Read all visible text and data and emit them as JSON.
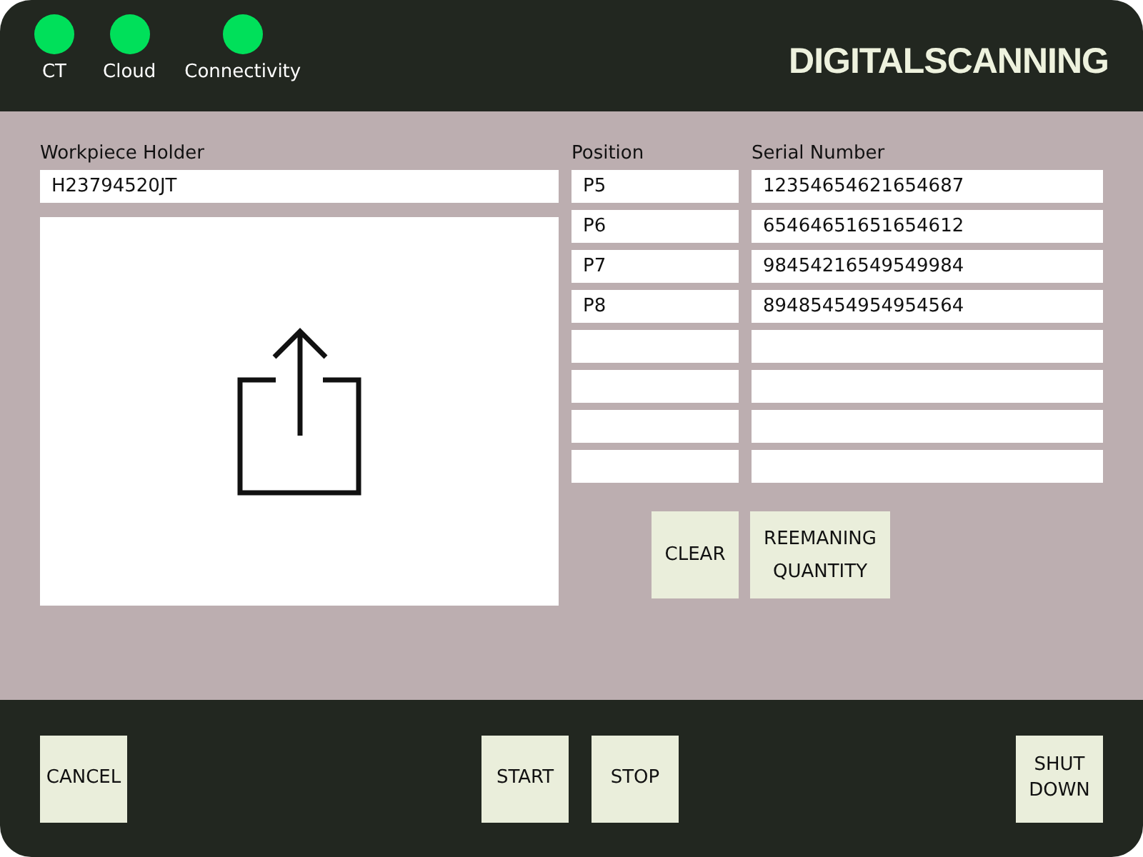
{
  "header": {
    "indicators": [
      {
        "label": "CT",
        "color": "#00e05a"
      },
      {
        "label": "Cloud",
        "color": "#00e05a"
      },
      {
        "label": "Connectivity",
        "color": "#00e05a"
      }
    ],
    "title": "DIGITALSCANNING"
  },
  "workpiece": {
    "label": "Workpiece Holder",
    "value": "H23794520JT",
    "upload": {
      "kind": "picture-upload"
    }
  },
  "table": {
    "columns": [
      "Position",
      "Serial Number"
    ],
    "rows": [
      {
        "kind": "filled",
        "position": "P5",
        "serial": "12354654621654687"
      },
      {
        "kind": "filled",
        "position": "P6",
        "serial": "65464651651654612"
      },
      {
        "kind": "filled",
        "position": "P7",
        "serial": "98454216549549984"
      },
      {
        "kind": "filled",
        "position": "P8",
        "serial": "89485454954954564"
      },
      {
        "kind": "blank"
      },
      {
        "kind": "blank"
      },
      {
        "kind": "blank"
      },
      {
        "kind": "blank"
      }
    ]
  },
  "actions": [
    "CLEAR",
    "REEMANING QUANTITY"
  ],
  "footer": {
    "left_buttons": [
      "CANCEL"
    ],
    "center_buttons": [
      "START",
      "STOP"
    ],
    "right_buttons": [
      "SHUT DOWN"
    ]
  }
}
